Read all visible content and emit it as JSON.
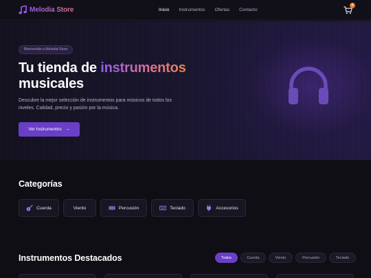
{
  "header": {
    "brand": "Melodia Store",
    "nav": [
      {
        "label": "Inicio",
        "active": true
      },
      {
        "label": "Instrumentos",
        "active": false
      },
      {
        "label": "Ofertas",
        "active": false
      },
      {
        "label": "Contacto",
        "active": false
      }
    ],
    "cart_count": "0",
    "icons": {
      "brand": "music-note-icon",
      "cart": "shopping-cart-icon"
    }
  },
  "hero": {
    "badge": "Bienvenido a Melodia Store",
    "title_prefix": "Tu tienda de",
    "title_accent": "instrumentos",
    "title_suffix": "musicales",
    "description": "Descubre la mejor selección de instrumentos para músicos de todos los niveles. Calidad, precio y pasión por la música.",
    "button_label": "Ver Instrumentos",
    "button_icon": "arrow-right-icon",
    "art_icon": "headphones-icon"
  },
  "categories": {
    "title": "Categorías",
    "items": [
      {
        "label": "Cuerda",
        "icon": "guitar-icon"
      },
      {
        "label": "Viento",
        "icon": ""
      },
      {
        "label": "Percusión",
        "icon": "drum-icon"
      },
      {
        "label": "Teclado",
        "icon": "keyboard-icon"
      },
      {
        "label": "Accesorios",
        "icon": "plug-icon"
      }
    ]
  },
  "featured": {
    "title": "Instrumentos Destacados",
    "filters": [
      {
        "label": "Todos",
        "active": true
      },
      {
        "label": "Cuerda",
        "active": false
      },
      {
        "label": "Viento",
        "active": false
      },
      {
        "label": "Percusión",
        "active": false
      },
      {
        "label": "Teclado",
        "active": false
      }
    ]
  },
  "colors": {
    "background": "#0f0e14",
    "accent": "#6a3fc7",
    "badge_orange": "#e07b2e",
    "gradient_start": "#8f5cf0",
    "gradient_end": "#e8874f"
  }
}
